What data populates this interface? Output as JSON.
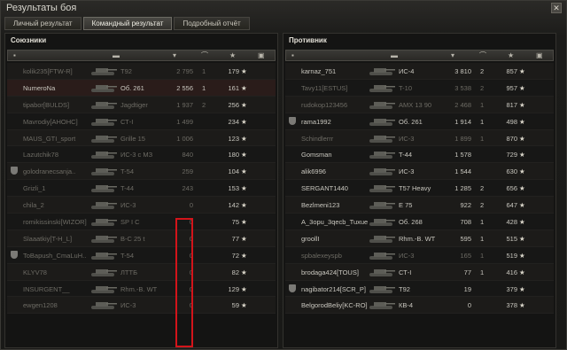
{
  "window": {
    "title": "Результаты боя"
  },
  "tabs": [
    "Личный результат",
    "Командный результат",
    "Подробный отчёт"
  ],
  "allies": {
    "title": "Союзники",
    "rows": [
      {
        "player": "kolik235[FTW-R]",
        "tank": "T92",
        "damage": "2 795",
        "frags": "1",
        "xp": "179",
        "dead": true,
        "badge": false
      },
      {
        "player": "NumeroNa",
        "tank": "Об. 261",
        "damage": "2 556",
        "frags": "1",
        "xp": "161",
        "dead": false,
        "badge": false,
        "me": true
      },
      {
        "player": "tipabor[BULDS]",
        "tank": "Jagdtiger",
        "damage": "1 937",
        "frags": "2",
        "xp": "256",
        "dead": true,
        "badge": false
      },
      {
        "player": "Mavrodiy[AHOHC]",
        "tank": "СТ-I",
        "damage": "1 499",
        "frags": "",
        "xp": "234",
        "dead": true,
        "badge": false
      },
      {
        "player": "MAUS_GTI_sport",
        "tank": "Grille 15",
        "damage": "1 006",
        "frags": "",
        "xp": "123",
        "dead": true,
        "badge": false
      },
      {
        "player": "Lazutchik78",
        "tank": "ИС-3 с МЗ",
        "damage": "840",
        "frags": "",
        "xp": "180",
        "dead": true,
        "badge": false
      },
      {
        "player": "golodranecsanja..",
        "tank": "T-54",
        "damage": "259",
        "frags": "",
        "xp": "104",
        "dead": true,
        "badge": true
      },
      {
        "player": "Grizli_1",
        "tank": "T-44",
        "damage": "243",
        "frags": "",
        "xp": "153",
        "dead": true,
        "badge": false
      },
      {
        "player": "chila_2",
        "tank": "ИС-3",
        "damage": "0",
        "frags": "",
        "xp": "142",
        "dead": true,
        "badge": false
      },
      {
        "player": "romikissinski[WIZOR]",
        "tank": "SP I C",
        "damage": "0",
        "frags": "",
        "xp": "75",
        "dead": true,
        "badge": false
      },
      {
        "player": "Slaaatkiy[T-H_L]",
        "tank": "B-C 25 t",
        "damage": "0",
        "frags": "",
        "xp": "77",
        "dead": true,
        "badge": false
      },
      {
        "player": "ToBapush_CmaLuH..",
        "tank": "T-54",
        "damage": "0",
        "frags": "",
        "xp": "72",
        "dead": true,
        "badge": true
      },
      {
        "player": "KLYV78",
        "tank": "ЛТТБ",
        "damage": "0",
        "frags": "",
        "xp": "82",
        "dead": true,
        "badge": false
      },
      {
        "player": "INSURGENT__",
        "tank": "Rhm.-B. WT",
        "damage": "0",
        "frags": "",
        "xp": "129",
        "dead": true,
        "badge": false
      },
      {
        "player": "ewgen1208",
        "tank": "ИС-3",
        "damage": "0",
        "frags": "",
        "xp": "59",
        "dead": true,
        "badge": false
      }
    ]
  },
  "enemies": {
    "title": "Противник",
    "rows": [
      {
        "player": "karnaz_751",
        "tank": "ИС-4",
        "damage": "3 810",
        "frags": "2",
        "xp": "857",
        "dead": false,
        "badge": false
      },
      {
        "player": "Tavy11[ESTUS]",
        "tank": "T-10",
        "damage": "3 538",
        "frags": "2",
        "xp": "957",
        "dead": true,
        "badge": false
      },
      {
        "player": "rudokop123456",
        "tank": "AMX 13 90",
        "damage": "2 468",
        "frags": "1",
        "xp": "817",
        "dead": true,
        "badge": false
      },
      {
        "player": "rama1992",
        "tank": "Об. 261",
        "damage": "1 914",
        "frags": "1",
        "xp": "498",
        "dead": false,
        "badge": true
      },
      {
        "player": "Schindlerrr",
        "tank": "ИС-3",
        "damage": "1 899",
        "frags": "1",
        "xp": "870",
        "dead": true,
        "badge": false
      },
      {
        "player": "Gomsman",
        "tank": "T-44",
        "damage": "1 578",
        "frags": "",
        "xp": "729",
        "dead": false,
        "badge": false
      },
      {
        "player": "alik6996",
        "tank": "ИС-3",
        "damage": "1 544",
        "frags": "",
        "xp": "630",
        "dead": false,
        "badge": false
      },
      {
        "player": "SERGANT1440",
        "tank": "T57 Heavy",
        "damage": "1 285",
        "frags": "2",
        "xp": "656",
        "dead": false,
        "badge": false
      },
      {
        "player": "Bezlmeni123",
        "tank": "E 75",
        "damage": "922",
        "frags": "2",
        "xp": "647",
        "dead": false,
        "badge": false
      },
      {
        "player": "A_3opu_3qecb_Tuxue",
        "tank": "Об. 268",
        "damage": "708",
        "frags": "1",
        "xp": "428",
        "dead": false,
        "badge": false
      },
      {
        "player": "groollI",
        "tank": "Rhm.-B. WT",
        "damage": "595",
        "frags": "1",
        "xp": "515",
        "dead": false,
        "badge": false
      },
      {
        "player": "spbalexeyspb",
        "tank": "ИС-3",
        "damage": "165",
        "frags": "1",
        "xp": "519",
        "dead": true,
        "badge": false
      },
      {
        "player": "brodaga424[TOUS]",
        "tank": "СТ-I",
        "damage": "77",
        "frags": "1",
        "xp": "416",
        "dead": false,
        "badge": false
      },
      {
        "player": "nagibator214[SCR_P]",
        "tank": "T92",
        "damage": "19",
        "frags": "",
        "xp": "379",
        "dead": false,
        "badge": true
      },
      {
        "player": "BelgorodBeliy[KC-RO]",
        "tank": "КВ-4",
        "damage": "0",
        "frags": "",
        "xp": "378",
        "dead": false,
        "badge": false
      }
    ]
  },
  "colors": {
    "accent": "#d3141a",
    "dead": "#6d6b64",
    "text": "#c9c7bf"
  },
  "icons": [
    "close-icon",
    "badge-icon",
    "tank-icon",
    "frags-icon",
    "xp-star-icon"
  ]
}
